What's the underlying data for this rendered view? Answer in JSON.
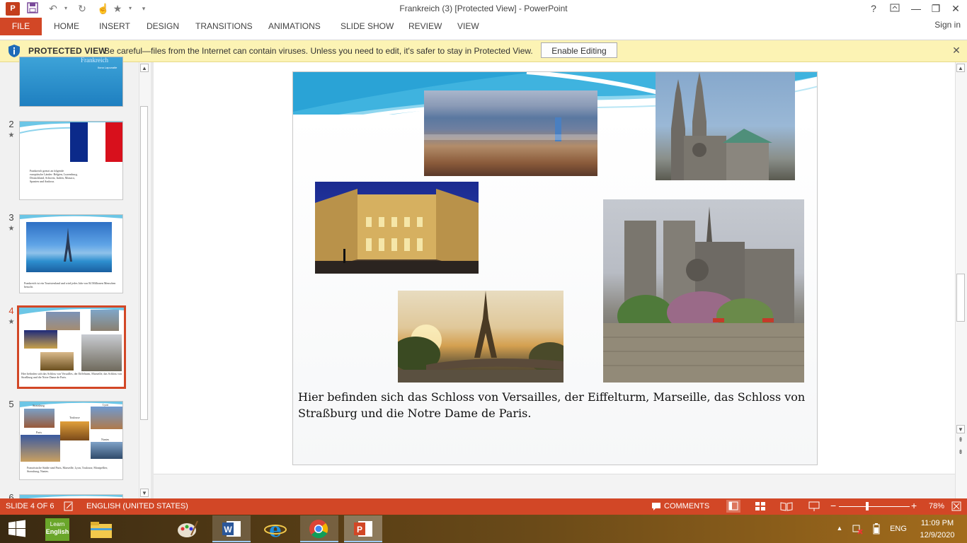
{
  "window": {
    "title": "Frankreich (3) [Protected View] - PowerPoint",
    "help": "?",
    "sign_in": "Sign in"
  },
  "app_icon_letter": "P",
  "ribbon": {
    "file": "FILE",
    "tabs": [
      "HOME",
      "INSERT",
      "DESIGN",
      "TRANSITIONS",
      "ANIMATIONS",
      "SLIDE SHOW",
      "REVIEW",
      "VIEW"
    ]
  },
  "protected_view": {
    "title": "PROTECTED VIEW",
    "message": "Be careful—files from the Internet can contain viruses. Unless you need to edit, it's safer to stay in Protected View.",
    "button": "Enable Editing"
  },
  "thumbnails": [
    {
      "num": "",
      "title": "Frankreich",
      "subtitle": "Ilona Lapunaite"
    },
    {
      "num": "2",
      "text": "Frankreich grenzt an folgende europäische Länder: Belgien, Luxemburg, Deutschland, Schweiz, Italien, Monaco, Spanien und Andorra."
    },
    {
      "num": "3",
      "text": "Frankreich ist ein Touristenland und wird jedes Jahr von 84 Millionen Menschen besucht."
    },
    {
      "num": "4",
      "text": "Hier befinden sich das Schloss von Versailles, der Eiffelturm, Marseille, das Schloss von Straßburg und die Notre Dame de Paris."
    },
    {
      "num": "5",
      "labels": [
        "Strassburg",
        "Lyon",
        "Toulouse",
        "Paris",
        "Nantes"
      ],
      "text": "Französische Städte sind Paris, Marseille, Lyon, Toulouse, Montpellier, Strassburg, Nantes."
    },
    {
      "num": "6"
    }
  ],
  "slide": {
    "caption": "Hier befinden sich das Schloss von Versailles, der Eiffelturm, Marseille, das Schloss von Straßburg und die Notre Dame de Paris."
  },
  "status": {
    "slide": "SLIDE 4 OF 6",
    "language": "ENGLISH (UNITED STATES)",
    "comments": "COMMENTS",
    "zoom_label": "78%",
    "zoom_level": 0.4
  },
  "taskbar": {
    "learn_top": "Learn",
    "learn_bottom": "English",
    "tray_language": "ENG",
    "time": "11:09 PM",
    "date": "12/9/2020"
  },
  "colors": {
    "accent": "#d24726",
    "protected_bar": "#fcf3b4",
    "selection": "#d24726"
  }
}
